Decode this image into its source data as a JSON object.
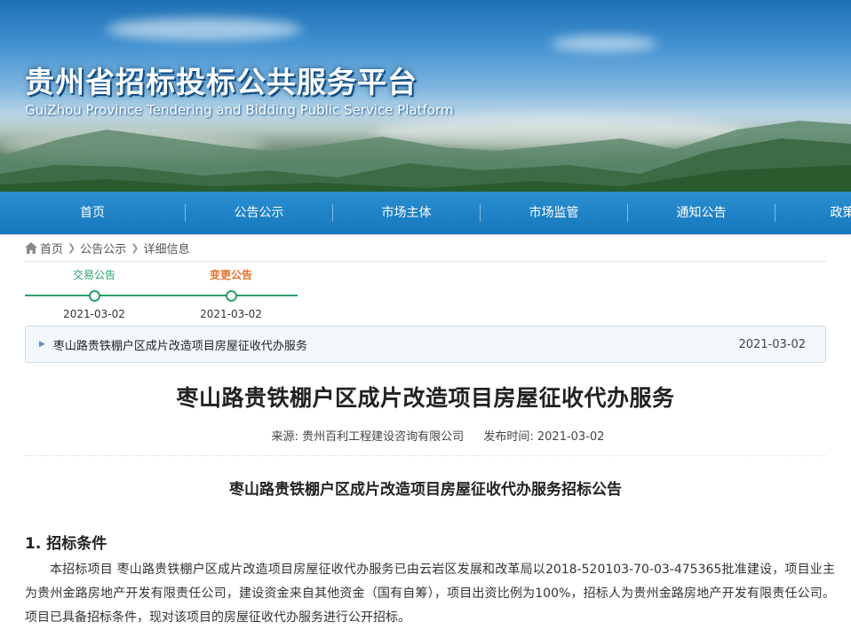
{
  "banner": {
    "title": "贵州省招标投标公共服务平台",
    "subtitle": "GuiZhou Province Tendering and Bidding Public Service Platform"
  },
  "nav": {
    "items": [
      "首页",
      "公告公示",
      "市场主体",
      "市场监管",
      "通知公告",
      "政策法"
    ]
  },
  "breadcrumb": {
    "home_icon": "home-icon",
    "items": [
      "首页",
      "公告公示",
      "详细信息"
    ]
  },
  "timeline": {
    "steps": [
      {
        "label": "交易公告",
        "date": "2021-03-02",
        "color": "#27a06b"
      },
      {
        "label": "变更公告",
        "date": "2021-03-02",
        "color": "#e5702a"
      }
    ]
  },
  "notice": {
    "title": "枣山路贵铁棚户区成片改造项目房屋征收代办服务",
    "date": "2021-03-02"
  },
  "article": {
    "title": "枣山路贵铁棚户区成片改造项目房屋征收代办服务",
    "source_label": "来源:",
    "source": "贵州百利工程建设咨询有限公司",
    "published_label": "发布时间:",
    "published": "2021-03-02",
    "subtitle": "枣山路贵铁棚户区成片改造项目房屋征收代办服务招标公告",
    "section1_heading": "1. 招标条件",
    "section1_body": "本招标项目 枣山路贵铁棚户区成片改造项目房屋征收代办服务已由云岩区发展和改革局以2018-520103-70-03-475365批准建设，项目业主为贵州金路房地产开发有限责任公司，建设资金来自其他资金（国有自筹），项目出资比例为100%，招标人为贵州金路房地产开发有限责任公司。项目已具备招标条件，现对该项目的房屋征收代办服务进行公开招标。"
  },
  "colors": {
    "nav_bg": "#1677bd",
    "accent_green": "#27a06b",
    "accent_orange": "#e5702a"
  }
}
